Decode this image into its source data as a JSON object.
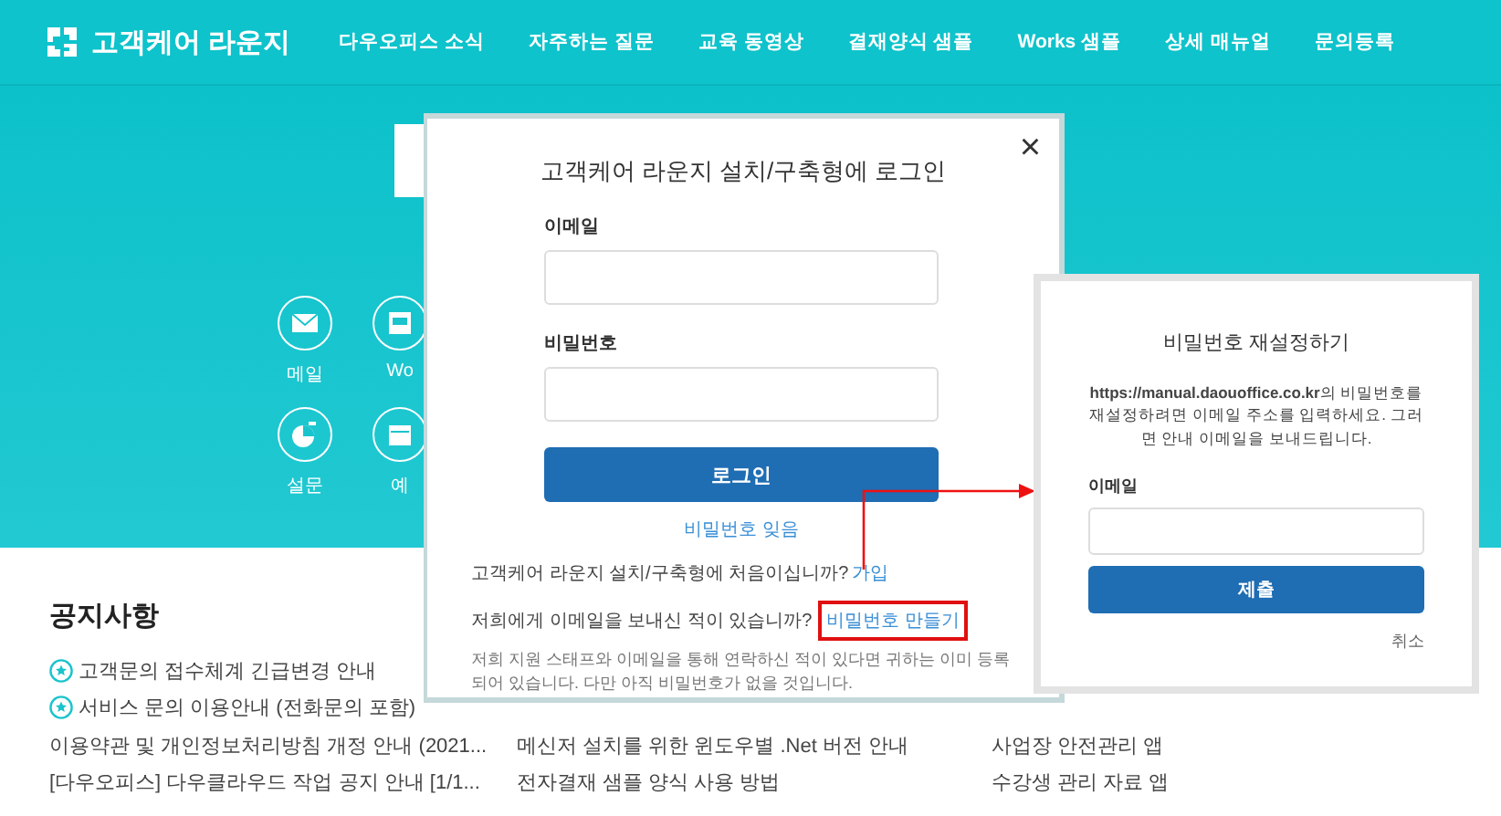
{
  "header": {
    "logo": "고객케어 라운지",
    "nav": [
      {
        "label": "다우오피스 소식"
      },
      {
        "label": "자주하는 질문"
      },
      {
        "label": "교육 동영상"
      },
      {
        "label": "결재양식 샘플"
      },
      {
        "label": "Works 샘플"
      },
      {
        "label": "상세 매뉴얼"
      },
      {
        "label": "문의등록"
      }
    ]
  },
  "hero": {
    "shortcuts": [
      {
        "label": "메일",
        "kind": "mail"
      },
      {
        "label": "Wo",
        "kind": "board"
      },
      {
        "label": "설문",
        "kind": "chart"
      },
      {
        "label": "예",
        "kind": "calendar"
      }
    ]
  },
  "notices": {
    "title": "공지사항",
    "columns": [
      [
        {
          "text": "고객문의 접수체계 긴급변경 안내",
          "pinned": true
        },
        {
          "text": "서비스 문의 이용안내 (전화문의 포함)",
          "pinned": true
        },
        {
          "text": "이용약관 및 개인정보처리방침 개정 안내 (2021...",
          "pinned": false
        },
        {
          "text": "[다우오피스] 다우클라우드 작업 공지 안내 [1/1...",
          "pinned": false
        }
      ],
      [
        {
          "text": "메신저 설치를 위한 윈도우별 .Net 버전 안내",
          "pinned": false
        },
        {
          "text": "전자결재 샘플 양식 사용 방법",
          "pinned": false
        }
      ],
      [
        {
          "text": "사업장 안전관리 앱",
          "pinned": false
        },
        {
          "text": "수강생 관리 자료 앱",
          "pinned": false
        }
      ]
    ]
  },
  "login_dialog": {
    "close": "×",
    "title": "고객케어 라운지 설치/구축형에 로그인",
    "email_label": "이메일",
    "password_label": "비밀번호",
    "login_button": "로그인",
    "forgot_link": "비밀번호 잊음",
    "signup_prompt": "고객케어 라운지 설치/구축형에 처음이십니까?",
    "signup_link": "가입",
    "create_prompt": "저희에게 이메일을 보내신 적이 있습니까?",
    "create_link": "비밀번호 만들기",
    "note": "저희 지원 스태프와 이메일을 통해 연락하신 적이 있다면 귀하는 이미 등록되어 있습니다. 다만 아직 비밀번호가 없을 것입니다."
  },
  "reset_dialog": {
    "title": "비밀번호 재설정하기",
    "message": "**https://manual.daouoffice.co.kr**의 비밀번호를 재설정하려면 이메일 주소를 입력하세요. 그러면 안내 이메일을 보내드립니다.",
    "email_label": "이메일",
    "submit_button": "제출",
    "cancel_link": "취소"
  }
}
